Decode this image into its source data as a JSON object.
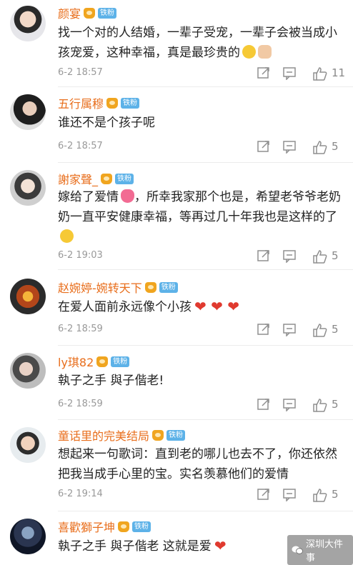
{
  "comments": [
    {
      "username": "颜宴",
      "badge": "铁粉",
      "text": "找一个对的人结婚，一辈子受宠，一辈子会被当成小孩宠爱，这种幸福，真是最珍贵的",
      "emojis": [
        "grin-emoji",
        "thumbs-up-emoji"
      ],
      "time": "6-2 18:57",
      "likes": "11"
    },
    {
      "username": "五行属穆",
      "badge": "铁粉",
      "text": "谁还不是个孩子呢",
      "time": "6-2 18:57",
      "likes": "5"
    },
    {
      "username": "謝家聲_",
      "badge": "铁粉",
      "text": "嫁给了爱情",
      "text_after_emoji": "，所幸我家那个也是，希望老爷爷老奶奶一直平安健康幸福，等再过几十年我也是这样的了",
      "emojis": [
        "pink-heart-emoji",
        "sad-emoji"
      ],
      "time": "6-2 19:03",
      "likes": "5"
    },
    {
      "username": "赵婉婷-婉转天下",
      "badge": "铁粉",
      "text": "在爱人面前永远像个小孩",
      "hearts": "❤ ❤ ❤",
      "time": "6-2 18:59",
      "likes": "5"
    },
    {
      "username": "ly琪82",
      "badge": "铁粉",
      "text": "執子之手 與子偕老!",
      "time": "6-2 18:59",
      "likes": "5"
    },
    {
      "username": "童话里的完美结局",
      "badge": "铁粉",
      "text": "想起来一句歌词：直到老的哪儿也去不了，你还依然把我当成手心里的宝。实名羡慕他们的爱情",
      "time": "6-2 19:14",
      "likes": "5"
    },
    {
      "username": "喜歡獅子坤",
      "badge": "铁粉",
      "text": "執子之手 與子偕老 这就是爱",
      "hearts": "❤"
    }
  ],
  "watermark": "深圳大件事",
  "colors": {
    "username": "#e86e1c",
    "badge": "#5db2e8",
    "crown": "#f0a51f",
    "time": "#999999",
    "icon": "#8f8f8f"
  }
}
